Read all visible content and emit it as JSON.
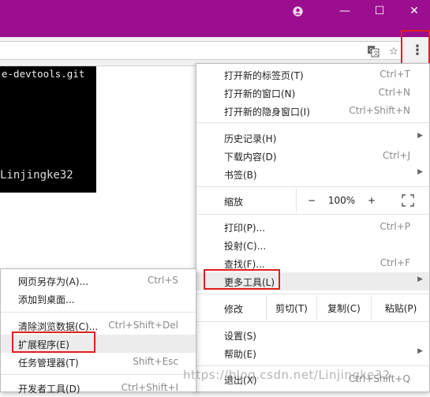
{
  "window": {
    "profile_icon": "profile-icon",
    "minimize_glyph": "—",
    "maximize_glyph": "☐",
    "close_glyph": "✕"
  },
  "toolbar": {
    "translate_icon": "translate-icon",
    "star_glyph": "☆",
    "menu_glyph": "⋮"
  },
  "terminal": {
    "line1": "e-devtools.git",
    "watermark": "Linjingke32"
  },
  "main_menu": {
    "new_tab": {
      "label": "打开新的标签页(T)",
      "shortcut": "Ctrl+T"
    },
    "new_window": {
      "label": "打开新的窗口(N)",
      "shortcut": "Ctrl+N"
    },
    "new_incognito": {
      "label": "打开新的隐身窗口(I)",
      "shortcut": "Ctrl+Shift+N"
    },
    "history": {
      "label": "历史记录(H)"
    },
    "downloads": {
      "label": "下载内容(D)",
      "shortcut": "Ctrl+J"
    },
    "bookmarks": {
      "label": "书签(B)"
    },
    "zoom": {
      "label": "缩放",
      "minus": "−",
      "value": "100%",
      "plus": "+",
      "fullscreen_glyph": "⛶"
    },
    "print": {
      "label": "打印(P)...",
      "shortcut": "Ctrl+P"
    },
    "cast": {
      "label": "投射(C)..."
    },
    "find": {
      "label": "查找(F)...",
      "shortcut": "Ctrl+F"
    },
    "more_tools": {
      "label": "更多工具(L)"
    },
    "edit": {
      "label": "修改",
      "cut": "剪切(T)",
      "copy": "复制(C)",
      "paste": "粘贴(P)"
    },
    "settings": {
      "label": "设置(S)"
    },
    "help": {
      "label": "帮助(E)"
    },
    "exit": {
      "label": "退出(X)",
      "shortcut": "Ctrl+Shift+Q"
    },
    "arrow_glyph": "▶"
  },
  "sub_menu": {
    "save_page": {
      "label": "网页另存为(A)...",
      "shortcut": "Ctrl+S"
    },
    "add_to_desktop": {
      "label": "添加到桌面..."
    },
    "clear_data": {
      "label": "清除浏览数据(C)...",
      "shortcut": "Ctrl+Shift+Del"
    },
    "extensions": {
      "label": "扩展程序(E)"
    },
    "task_manager": {
      "label": "任务管理器(T)",
      "shortcut": "Shift+Esc"
    },
    "dev_tools": {
      "label": "开发者工具(D)",
      "shortcut": "Ctrl+Shift+I"
    }
  },
  "watermark": "https://blog.csdn.net/Linjingke32"
}
